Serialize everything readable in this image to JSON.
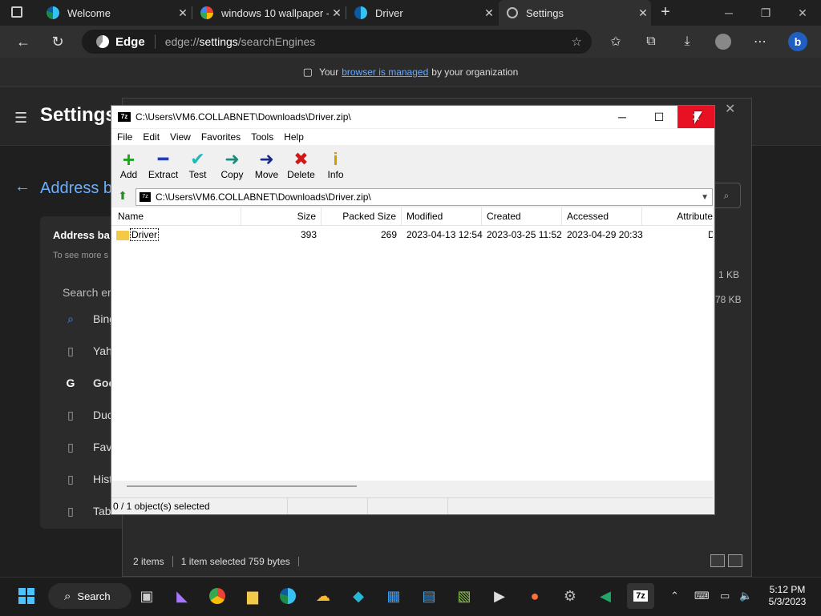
{
  "browser": {
    "tabs": [
      {
        "title": "Welcome",
        "icon": "edge-icon"
      },
      {
        "title": "windows 10 wallpaper -",
        "icon": "google-icon"
      },
      {
        "title": "Driver",
        "icon": "edge-icon"
      },
      {
        "title": "Settings",
        "icon": "gear-icon"
      }
    ],
    "edge_label": "Edge",
    "url_prefix": "edge://",
    "url_bold": "settings",
    "url_rest": "/searchEngines",
    "managed": {
      "pre": "Your",
      "link": "browser is managed",
      "post": "by your organization"
    }
  },
  "settings": {
    "title": "Settings",
    "section_title": "Address b",
    "card_title": "Address ba",
    "card_sub": "To see more s",
    "search_placeholder": "Search en",
    "engines": [
      "Bing",
      "Yah",
      "Goo",
      "Duc",
      "Fav",
      "Hist",
      "Tab"
    ],
    "right_sizes": [
      "1 KB",
      "78 KB"
    ],
    "status": {
      "items": "2 items",
      "selected": "1 item selected  759 bytes"
    }
  },
  "sevenzip": {
    "title": "C:\\Users\\VM6.COLLABNET\\Downloads\\Driver.zip\\",
    "logo": "7z",
    "menu": [
      "File",
      "Edit",
      "View",
      "Favorites",
      "Tools",
      "Help"
    ],
    "toolbar": [
      {
        "label": "Add",
        "glyph": "+",
        "color": "#1fa41f",
        "icon": "add-icon"
      },
      {
        "label": "Extract",
        "glyph": "—",
        "color": "#1a3ec8",
        "icon": "extract-icon"
      },
      {
        "label": "Test",
        "glyph": "✔",
        "color": "#1fb9b9",
        "icon": "test-icon"
      },
      {
        "label": "Copy",
        "glyph": "➜",
        "color": "#1b8a7a",
        "icon": "copy-icon"
      },
      {
        "label": "Move",
        "glyph": "➜",
        "color": "#1a2a8a",
        "icon": "move-icon"
      },
      {
        "label": "Delete",
        "glyph": "✖",
        "color": "#d01818",
        "icon": "delete-icon"
      },
      {
        "label": "Info",
        "glyph": "i",
        "color": "#c8a000",
        "icon": "info-icon"
      }
    ],
    "path": "C:\\Users\\VM6.COLLABNET\\Downloads\\Driver.zip\\",
    "columns": [
      "Name",
      "Size",
      "Packed Size",
      "Modified",
      "Created",
      "Accessed",
      "Attribute"
    ],
    "rows": [
      {
        "name": "Driver",
        "size": "393",
        "packed": "269",
        "modified": "2023-04-13 12:54",
        "created": "2023-03-25 11:52",
        "accessed": "2023-04-29 20:33",
        "attr": "D"
      }
    ],
    "status": "0 / 1 object(s) selected"
  },
  "taskbar": {
    "search_label": "Search",
    "time": "5:12 PM",
    "date": "5/3/2023"
  }
}
